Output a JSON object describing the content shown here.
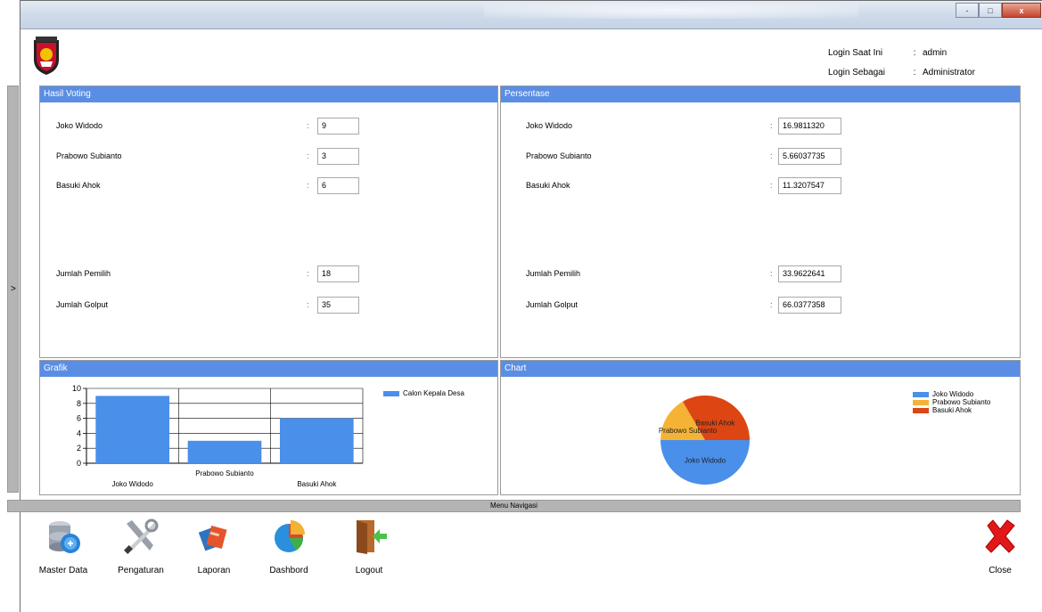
{
  "window": {
    "buttons": [
      "-",
      "□",
      "x"
    ]
  },
  "header": {
    "login_now_label": "Login Saat Ini",
    "login_now_value": "admin",
    "login_as_label": "Login Sebagai",
    "login_as_value": "Administrator",
    "colon": ":"
  },
  "side_toggle": ">",
  "hasil_voting": {
    "title": "Hasil Voting",
    "rows": [
      {
        "label": "Joko Widodo",
        "value": "9"
      },
      {
        "label": "Prabowo Subianto",
        "value": "3"
      },
      {
        "label": "Basuki Ahok",
        "value": "6"
      },
      {
        "label": "Jumlah Pemilih",
        "value": "18"
      },
      {
        "label": "Jumlah Golput",
        "value": "35"
      }
    ]
  },
  "persentase": {
    "title": "Persentase",
    "rows": [
      {
        "label": "Joko Widodo",
        "value": "16.9811320"
      },
      {
        "label": "Prabowo Subianto",
        "value": "5.66037735"
      },
      {
        "label": "Basuki Ahok",
        "value": "11.3207547"
      },
      {
        "label": "Jumlah Pemilih",
        "value": "33.9622641"
      },
      {
        "label": "Jumlah Golput",
        "value": "66.0377358"
      }
    ]
  },
  "grafik": {
    "title": "Grafik"
  },
  "chart": {
    "title": "Chart"
  },
  "chart_data": [
    {
      "type": "bar",
      "categories": [
        "Joko Widodo",
        "Prabowo Subianto",
        "Basuki Ahok"
      ],
      "series": [
        {
          "name": "Calon Kepala Desa",
          "values": [
            9,
            3,
            6
          ],
          "color": "#4a8fea"
        }
      ],
      "yticks": [
        0,
        2,
        4,
        6,
        8,
        10
      ],
      "ylim": [
        0,
        10
      ],
      "legend": "top-right",
      "grid": true
    },
    {
      "type": "pie",
      "labels": [
        "Joko Widodo",
        "Prabowo Subianto",
        "Basuki Ahok"
      ],
      "values": [
        9,
        3,
        6
      ],
      "colors": [
        "#4a8fea",
        "#f5b335",
        "#dd4512"
      ],
      "legend": "top-right"
    }
  ],
  "nav": {
    "title": "Menu Navigasi",
    "items": [
      {
        "label": "Master Data",
        "icon": "database-icon"
      },
      {
        "label": "Pengaturan",
        "icon": "tools-icon"
      },
      {
        "label": "Laporan",
        "icon": "books-icon"
      },
      {
        "label": "Dashbord",
        "icon": "pie-chart-icon"
      },
      {
        "label": "Logout",
        "icon": "logout-door-icon"
      }
    ],
    "close_label": "Close"
  }
}
